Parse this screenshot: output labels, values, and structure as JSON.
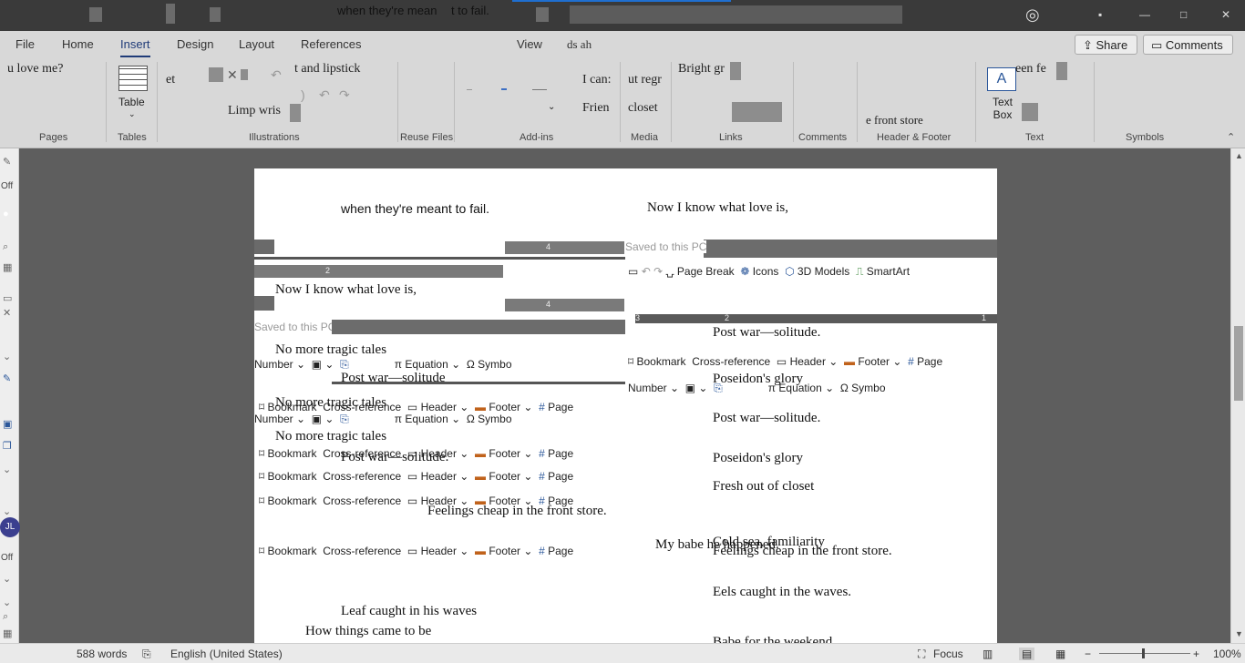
{
  "titlebar": {
    "fragment": "when they're mean",
    "fragment2": "t to fail."
  },
  "tabs": [
    "File",
    "Home",
    "Insert",
    "Design",
    "Layout",
    "References",
    "View",
    "ds ah"
  ],
  "header_buttons": {
    "share": "Share",
    "comments": "Comments"
  },
  "ribbon": {
    "frag_love": "u love me?",
    "frag_et": "et",
    "frag_lipstick": "t and lipstick",
    "frag_limp": "Limp wris",
    "frag_icant": "I can:",
    "frag_frien": "Frien",
    "frag_utregr": "ut regr",
    "frag_closet": "closet",
    "frag_bright": "Bright gr",
    "frag_front": "e front store",
    "frag_een": "een fe",
    "table_label": "Table",
    "textbox_label": "Text Box",
    "groups": [
      "Pages",
      "Tables",
      "Illustrations",
      "Reuse Files",
      "Add-ins",
      "Media",
      "Links",
      "Comments",
      "Header & Footer",
      "Text",
      "Symbols"
    ]
  },
  "leftrail": {
    "off1": "Off",
    "off2": "Off",
    "avatar": "JL"
  },
  "document": {
    "l1": "when they're meant to fail.",
    "l2": "Now I know what love is,",
    "l3": "Now I know what love is,",
    "saved1": "Saved to this PC",
    "saved2": "Saved to this PC",
    "l4": "No more tragic tales",
    "l5": "Post war—solitude",
    "l6": "No more tragic tales",
    "l7": "No more tragic tales",
    "l8": "Post war—solitude.",
    "l9": "Feelings cheap in the front store.",
    "l10": "Leaf caught in his waves",
    "l11": "How things came to be",
    "r1": "Post war—solitude.",
    "r2": "Poseidon's glory",
    "r3": "Post war—solitude.",
    "r4": "Poseidon's glory",
    "r5": "Fresh out of closet",
    "r6": "My babe he happened.",
    "r7": "Cold sea, familiarity",
    "r8": "Feelings cheap in the front store.",
    "r9": "Eels caught in the waves.",
    "r10": "Babe for the weekend",
    "insert_row": {
      "page_break": "Page Break",
      "icons": "Icons",
      "models": "3D Models",
      "smartart": "SmartArt"
    },
    "strip_a": {
      "number": "Number",
      "equation": "Equation",
      "symbol": "Symbo"
    },
    "strip_b": {
      "bookmark": "Bookmark",
      "crossref": "Cross-reference",
      "header": "Header",
      "footer": "Footer",
      "page": "Page"
    },
    "ruler_nums": [
      "4",
      "2",
      "4",
      "3",
      "2",
      "1"
    ]
  },
  "status": {
    "words": "588 words",
    "language": "English (United States)",
    "focus": "Focus",
    "zoom": "100%"
  }
}
